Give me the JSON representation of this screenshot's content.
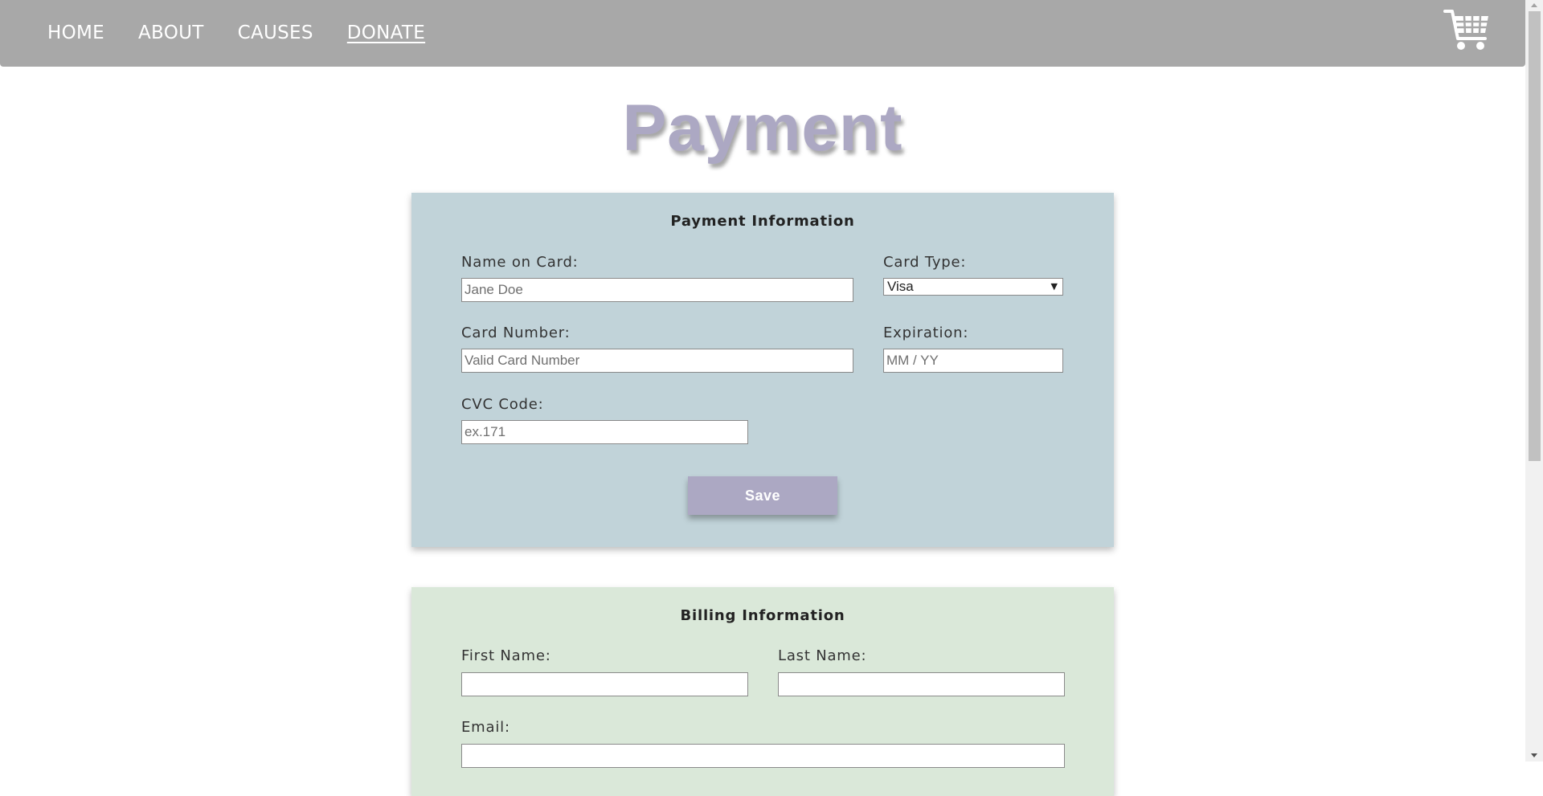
{
  "nav": {
    "links": [
      "HOME",
      "ABOUT",
      "CAUSES",
      "DONATE"
    ],
    "active_link": "DONATE",
    "cart_icon": "shopping-cart-icon"
  },
  "page": {
    "title": "Payment"
  },
  "payment_card": {
    "heading": "Payment Information",
    "name_label": "Name on Card:",
    "name_placeholder": "Jane Doe",
    "card_type_label": "Card Type:",
    "card_type_value": "Visa",
    "card_number_label": "Card Number:",
    "card_number_placeholder": "Valid Card Number",
    "expiration_label": "Expiration:",
    "expiration_placeholder": "MM / YY",
    "cvc_label": "CVC Code:",
    "cvc_placeholder": "ex.171",
    "save_label": "Save"
  },
  "billing_card": {
    "heading": "Billing Information",
    "first_name_label": "First Name:",
    "last_name_label": "Last Name:",
    "email_label": "Email:"
  },
  "colors": {
    "navbar": "#a8a8a8",
    "accent_purple": "#aca8c3",
    "payment_bg": "#c1d3d9",
    "billing_bg": "#dae8d9"
  }
}
